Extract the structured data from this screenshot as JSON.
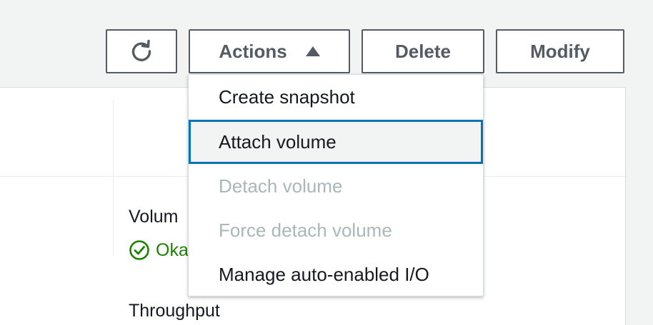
{
  "toolbar": {
    "refresh_icon": "refresh-icon",
    "actions_label": "Actions",
    "delete_label": "Delete",
    "modify_label": "Modify"
  },
  "actions_menu": {
    "items": [
      {
        "label": "Create snapshot",
        "state": "enabled"
      },
      {
        "label": "Attach volume",
        "state": "focused"
      },
      {
        "label": "Detach volume",
        "state": "disabled"
      },
      {
        "label": "Force detach volume",
        "state": "disabled"
      },
      {
        "label": "Manage auto-enabled I/O",
        "state": "enabled"
      }
    ]
  },
  "details": {
    "volume_state_label": "Volum",
    "status_text": "Oka",
    "throughput_label": "Throughput"
  },
  "colors": {
    "status_ok": "#1d8102",
    "focus_border": "#0073bb",
    "disabled_text": "#aab7b8",
    "button_border": "#545b64"
  }
}
